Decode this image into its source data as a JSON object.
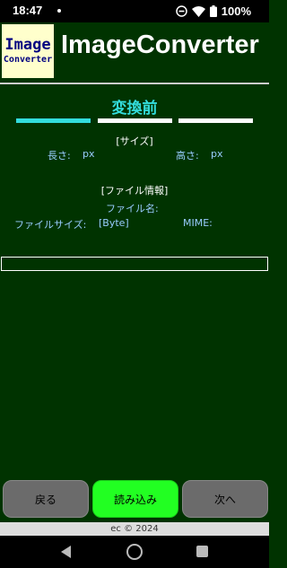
{
  "status_bar": {
    "time": "18:47",
    "battery": "100%"
  },
  "app": {
    "logo_line1": "Image",
    "logo_line2": "Converter",
    "title": "ImageConverter"
  },
  "section": {
    "title": "変換前"
  },
  "size": {
    "heading": "[サイズ]",
    "length_label": "長さ:",
    "length_unit": "px",
    "height_label": "高さ:",
    "height_unit": "px"
  },
  "file_info": {
    "heading": "[ファイル情報]",
    "name_label": "ファイル名:",
    "size_label": "ファイルサイズ:",
    "size_unit": "[Byte]",
    "mime_label": "MIME:"
  },
  "buttons": {
    "back": "戻る",
    "load": "読み込み",
    "next": "次へ"
  },
  "footer": {
    "copyright": "ec © 2024"
  },
  "colors": {
    "background": "#003300",
    "accent": "#33dddd",
    "load_button": "#22ff22",
    "secondary_button": "#6b6b6b"
  }
}
